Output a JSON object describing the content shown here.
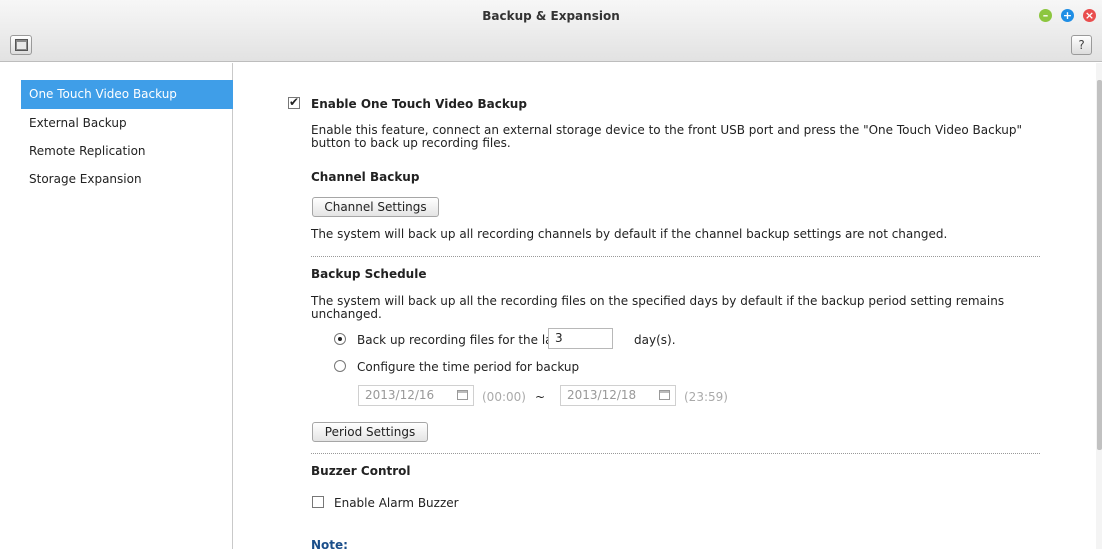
{
  "window": {
    "title": "Backup & Expansion",
    "help_label": "?"
  },
  "sidebar": {
    "items": [
      {
        "label": "One Touch Video Backup",
        "active": true
      },
      {
        "label": "External Backup",
        "active": false
      },
      {
        "label": "Remote Replication",
        "active": false
      },
      {
        "label": "Storage Expansion",
        "active": false
      }
    ]
  },
  "main": {
    "enable_label": "Enable One Touch Video Backup",
    "enable_checked": true,
    "enable_desc_1": "Enable this feature, connect an external storage device to the front USB port and press the \"One Touch Video Backup\"",
    "enable_desc_2": "button to back up recording files.",
    "channel": {
      "heading": "Channel Backup",
      "button_label": "Channel Settings",
      "desc": "The system will back up all recording channels by default if the channel backup settings are not changed."
    },
    "schedule": {
      "heading": "Backup Schedule",
      "desc_1": "The system will back up all the recording files on the specified days by default if the backup period setting remains",
      "desc_2": "unchanged.",
      "option1_label": "Back up recording files for the last",
      "days_value": "3",
      "days_unit": "day(s).",
      "option2_label": "Configure the time period for backup",
      "selected_option": 1,
      "start_date": "2013/12/16",
      "start_time": "(00:00)",
      "tilde": "~",
      "end_date": "2013/12/18",
      "end_time": "(23:59)",
      "button_label": "Period Settings"
    },
    "buzzer": {
      "heading": "Buzzer Control",
      "checkbox_label": "Enable Alarm Buzzer",
      "checked": false
    },
    "note_label": "Note:"
  }
}
